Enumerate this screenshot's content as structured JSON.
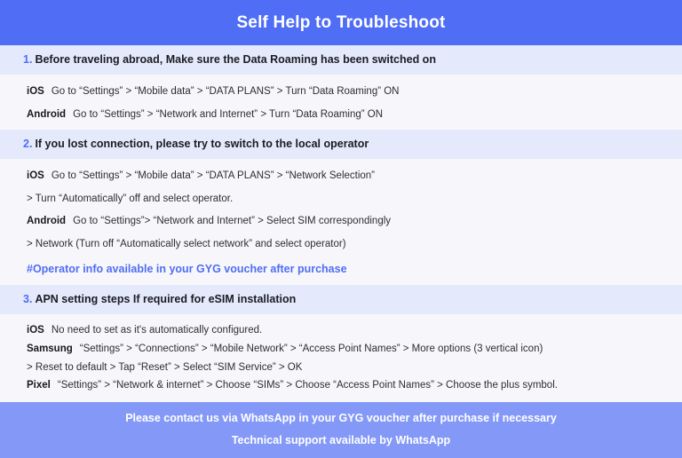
{
  "header": {
    "title": "Self Help to Troubleshoot",
    "background_color": "#4f6df5",
    "text_color": "#ffffff"
  },
  "colors": {
    "accent_blue": "#4f6df5",
    "band_blue": "#e4eafb",
    "page_background": "#f7f7fb",
    "footer_blue": "#8499f7",
    "body_text": "#2c2d33"
  },
  "sections": [
    {
      "number": "1.",
      "heading_lead": "Before traveling abroad,",
      "heading_rest": " Make sure the Data Roaming has been switched on",
      "rows": [
        {
          "os": "iOS",
          "text": "Go to “Settings” > “Mobile data” > “DATA PLANS” > Turn “Data Roaming” ON"
        },
        {
          "os": "Android",
          "text": "Go to “Settings” > “Network and Internet” > Turn “Data Roaming” ON"
        }
      ],
      "continuations": [],
      "note": ""
    },
    {
      "number": "2.",
      "heading_lead": "If you lost connection, please try to switch to the local operator",
      "heading_rest": "",
      "rows": [
        {
          "os": "iOS",
          "text": "Go to “Settings” > “Mobile data” > “DATA PLANS” > “Network Selection”",
          "continuation": "> Turn “Automatically” off and select operator."
        },
        {
          "os": "Android",
          "text": "Go to “Settings”>  “Network and Internet” > Select SIM correspondingly",
          "continuation": "> Network (Turn off “Automatically select network” and select operator)"
        }
      ],
      "note": "#Operator info available in your GYG voucher after purchase"
    },
    {
      "number": "3.",
      "heading_lead": "APN setting steps If required for eSIM installation",
      "heading_rest": "",
      "rows": [
        {
          "os": "iOS",
          "text": "No need to set as it's automatically configured.",
          "continuation": ""
        },
        {
          "os": "Samsung",
          "text": "“Settings” > “Connections” > “Mobile Network” > “Access Point Names” > More options (3 vertical icon)",
          "continuation": "> Reset to default > Tap “Reset” > Select “SIM Service” > OK"
        },
        {
          "os": "Pixel",
          "text": "“Settings” > “Network & internet” > Choose “SIMs” > Choose “Access Point Names” > Choose the plus symbol.",
          "continuation": ""
        }
      ],
      "note": ""
    }
  ],
  "footer": {
    "line1": "Please contact us via WhatsApp  in your GYG voucher after purchase if necessary",
    "line2": "Technical support available by WhatsApp"
  }
}
